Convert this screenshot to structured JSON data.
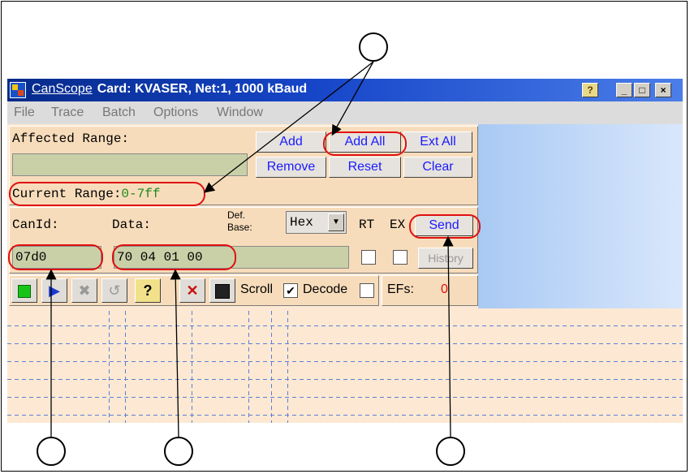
{
  "window": {
    "app_name": "CanScope",
    "title": "Card: KVASER, Net:1, 1000 kBaud"
  },
  "menu": [
    "File",
    "Trace",
    "Batch",
    "Options",
    "Window"
  ],
  "range_panel": {
    "affected_label": "Affected Range:",
    "current_label": "Current Range:",
    "current_value": "0-7ff",
    "buttons": {
      "add": "Add",
      "add_all": "Add All",
      "ext_all": "Ext All",
      "remove": "Remove",
      "reset": "Reset",
      "clear": "Clear"
    }
  },
  "send_panel": {
    "canid_label": "CanId:",
    "data_label": "Data:",
    "base_label_1": "Def.",
    "base_label_2": "Base:",
    "base_value": "Hex",
    "rt_label": "RT",
    "ex_label": "EX",
    "send_button": "Send",
    "history_button": "History",
    "canid_value": "07d0",
    "data_value": "70 04 01 00"
  },
  "toolbar": {
    "scroll_label": "Scroll",
    "decode_label": "Decode",
    "scroll_checked": true,
    "decode_checked": false,
    "efs_label": "EFs:",
    "efs_value": "0"
  },
  "colors": {
    "callout": "#e01010",
    "titlebar": "#1645c8",
    "panel": "#f7dcbb"
  }
}
